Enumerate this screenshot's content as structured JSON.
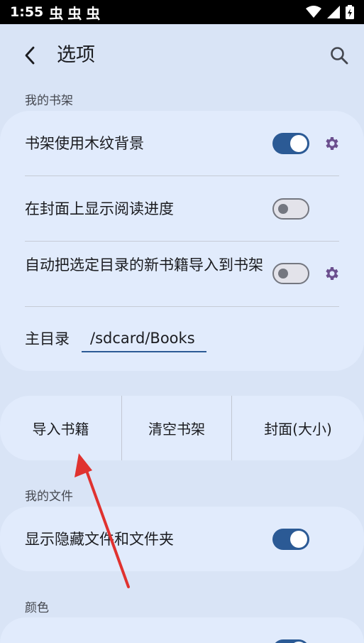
{
  "status_bar": {
    "time": "1:55",
    "notifications": [
      "虫",
      "虫",
      "虫"
    ]
  },
  "app_bar": {
    "title": "选项"
  },
  "sections": {
    "bookshelf": {
      "label": "我的书架",
      "items": [
        {
          "label": "书架使用木纹背景",
          "switch_on": true,
          "has_settings": true
        },
        {
          "label": "在封面上显示阅读进度",
          "switch_on": false,
          "has_settings": false
        },
        {
          "label": "自动把选定目录的新书籍导入到书架",
          "switch_on": false,
          "has_settings": true
        }
      ],
      "main_dir": {
        "label": "主目录",
        "value": "/sdcard/Books"
      }
    },
    "actions": {
      "buttons": [
        "导入书籍",
        "清空书架",
        "封面(大小)"
      ]
    },
    "files": {
      "label": "我的文件",
      "items": [
        {
          "label": "显示隐藏文件和文件夹",
          "switch_on": true
        }
      ]
    },
    "colors": {
      "label": "颜色"
    }
  },
  "colors": {
    "accent": "#2b5a95",
    "gear": "#6b4f8e",
    "annotation_arrow": "#e0322f"
  }
}
